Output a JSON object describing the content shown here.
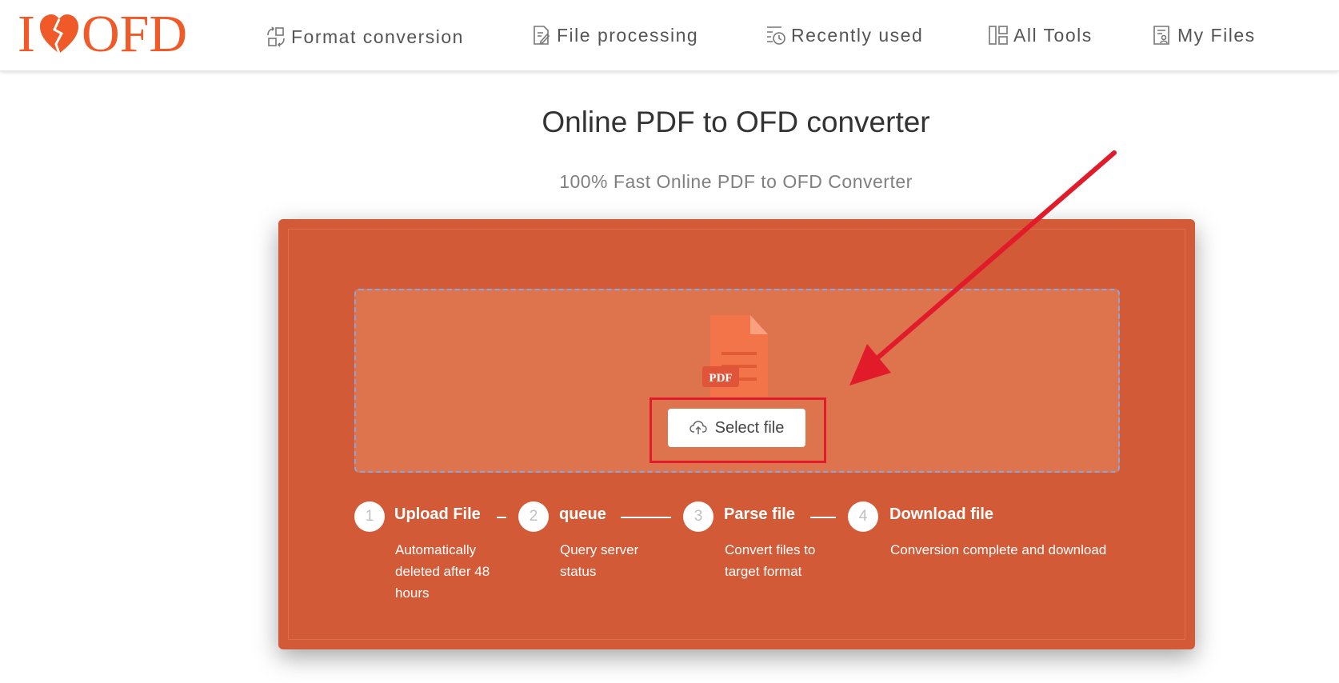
{
  "logo": {
    "prefix": "I",
    "suffix": "OFD"
  },
  "nav": {
    "format_conversion": "Format conversion",
    "file_processing": "File processing",
    "recently_used": "Recently used",
    "all_tools": "All Tools",
    "my_files": "My Files"
  },
  "page": {
    "title": "Online PDF to OFD converter",
    "subtitle": "100% Fast Online PDF to OFD Converter"
  },
  "upload": {
    "file_badge": "PDF",
    "select_label": "Select file"
  },
  "steps": [
    {
      "number": "1",
      "title": "Upload File",
      "desc": "Automatically deleted after 48 hours"
    },
    {
      "number": "2",
      "title": "queue",
      "desc": "Query server status"
    },
    {
      "number": "3",
      "title": "Parse file",
      "desc": "Convert files to target format"
    },
    {
      "number": "4",
      "title": "Download file",
      "desc": "Conversion complete and download"
    }
  ],
  "colors": {
    "brand": "#f05a28",
    "panel": "#d35a37",
    "dropzone": "#dd744e",
    "annotation": "#e21b2a"
  },
  "icons": {
    "format_conversion": "convert-icon",
    "file_processing": "edit-file-icon",
    "recently_used": "clock-list-icon",
    "all_tools": "grid-icon",
    "my_files": "user-file-icon",
    "upload": "cloud-upload-icon"
  }
}
